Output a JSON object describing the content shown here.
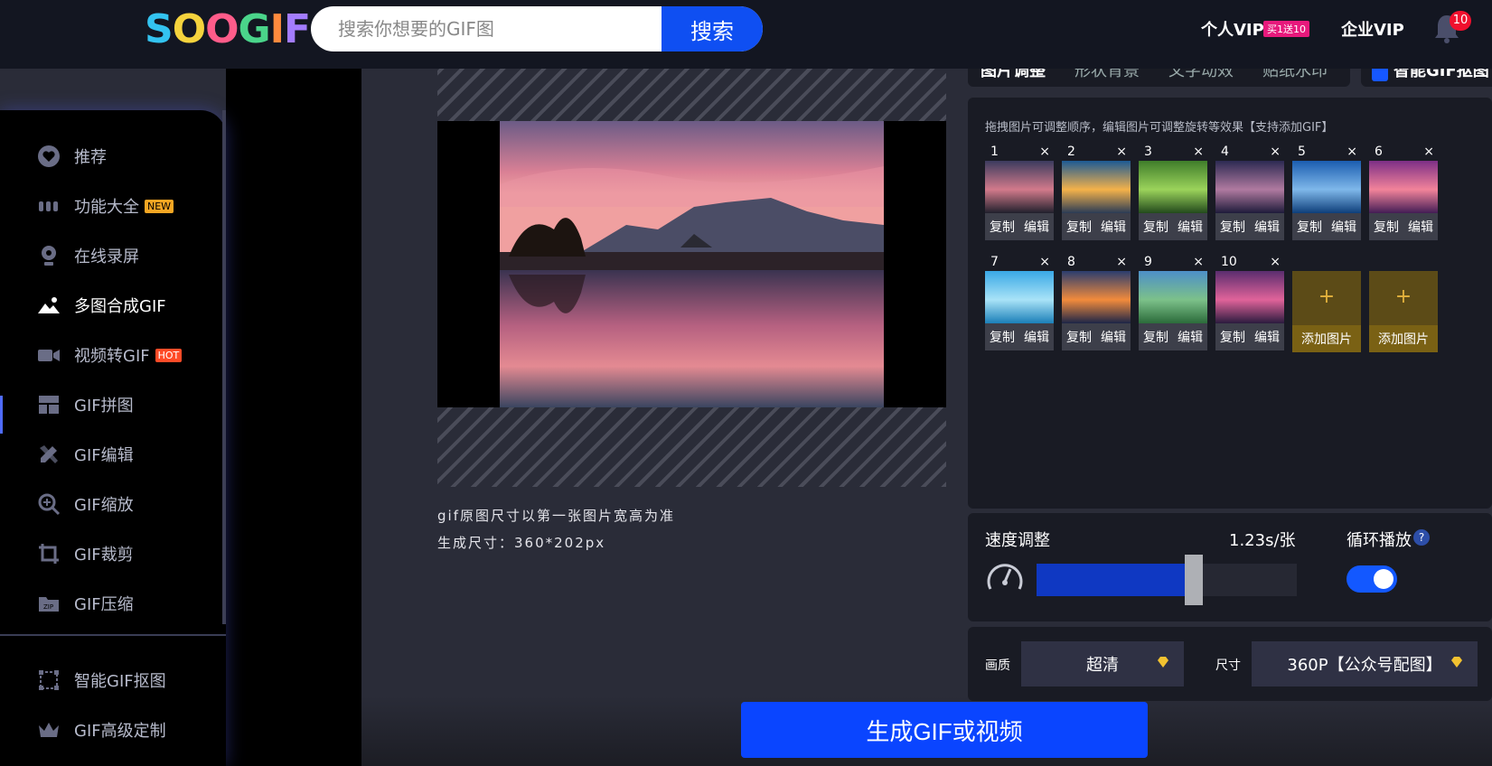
{
  "header": {
    "logo_text": "SOOGIF",
    "search_placeholder": "搜索你想要的GIF图",
    "search_button": "搜索",
    "vip_personal": "个人VIP",
    "vip_badge": "买1送10",
    "vip_enterprise": "企业VIP",
    "notification_count": "10"
  },
  "sidebar": {
    "items": [
      {
        "label": "推荐",
        "icon": "heart-icon"
      },
      {
        "label": "功能大全",
        "icon": "dots-icon",
        "tag": "NEW"
      },
      {
        "label": "在线录屏",
        "icon": "webcam-icon"
      },
      {
        "label": "多图合成GIF",
        "icon": "image-icon",
        "active": true
      },
      {
        "label": "视频转GIF",
        "icon": "video-icon",
        "tag": "HOT"
      },
      {
        "label": "GIF拼图",
        "icon": "grid-icon"
      },
      {
        "label": "GIF编辑",
        "icon": "edit-icon"
      },
      {
        "label": "GIF缩放",
        "icon": "zoom-icon"
      },
      {
        "label": "GIF裁剪",
        "icon": "crop-icon"
      },
      {
        "label": "GIF压缩",
        "icon": "zip-icon"
      },
      {
        "label": "智能GIF抠图",
        "icon": "cutout-icon"
      },
      {
        "label": "GIF高级定制",
        "icon": "crown-icon"
      }
    ]
  },
  "preview": {
    "note_size": "gif原图尺寸以第一张图片宽高为准",
    "note_generated": "生成尺寸：360*202px"
  },
  "tabs": {
    "items": [
      "图片调整",
      "形状背景",
      "文字动效",
      "贴纸水印"
    ],
    "smart_cutout": "智能GIF抠图"
  },
  "images_panel": {
    "hint": "拖拽图片可调整顺序，编辑图片可调整旋转等效果【支持添加GIF】",
    "copy_label": "复制",
    "edit_label": "编辑",
    "close_symbol": "×",
    "add_label": "添加图片",
    "add_symbol": "+",
    "thumbnails": [
      {
        "num": "1",
        "colors": [
          "#3b3b5e",
          "#d27a8b",
          "#20202c"
        ]
      },
      {
        "num": "2",
        "colors": [
          "#1c5a94",
          "#f4b24a",
          "#2a3b55"
        ]
      },
      {
        "num": "3",
        "colors": [
          "#3f7d2a",
          "#9bd35b",
          "#234a1c"
        ]
      },
      {
        "num": "4",
        "colors": [
          "#2c2a52",
          "#b07aa0",
          "#1e1b3a"
        ]
      },
      {
        "num": "5",
        "colors": [
          "#1b5db0",
          "#7fb8ea",
          "#0e3e7a"
        ]
      },
      {
        "num": "6",
        "colors": [
          "#7d2f86",
          "#f2839a",
          "#431d55"
        ]
      },
      {
        "num": "7",
        "colors": [
          "#39a8e6",
          "#a9e3f7",
          "#1b7fb8"
        ]
      },
      {
        "num": "8",
        "colors": [
          "#2b3d6e",
          "#f28b3c",
          "#1c2547"
        ]
      },
      {
        "num": "9",
        "colors": [
          "#4d8fc8",
          "#7cc18a",
          "#2b6b3a"
        ]
      },
      {
        "num": "10",
        "colors": [
          "#5a2d6e",
          "#e0639a",
          "#2b1b3e"
        ]
      }
    ]
  },
  "speed": {
    "title": "速度调整",
    "value": "1.23s/张",
    "level_fraction": 0.57,
    "loop_title": "循环播放",
    "help_symbol": "?",
    "loop_enabled": true
  },
  "quality": {
    "label": "画质",
    "value": "超清",
    "size_label": "尺寸",
    "size_value": "360P【公众号配图】"
  },
  "generate_button": "生成GIF或视频",
  "colors": {
    "accent": "#0a45ff",
    "topbar": "#131621",
    "panel": "#191b24",
    "background": "#2a2c38"
  }
}
